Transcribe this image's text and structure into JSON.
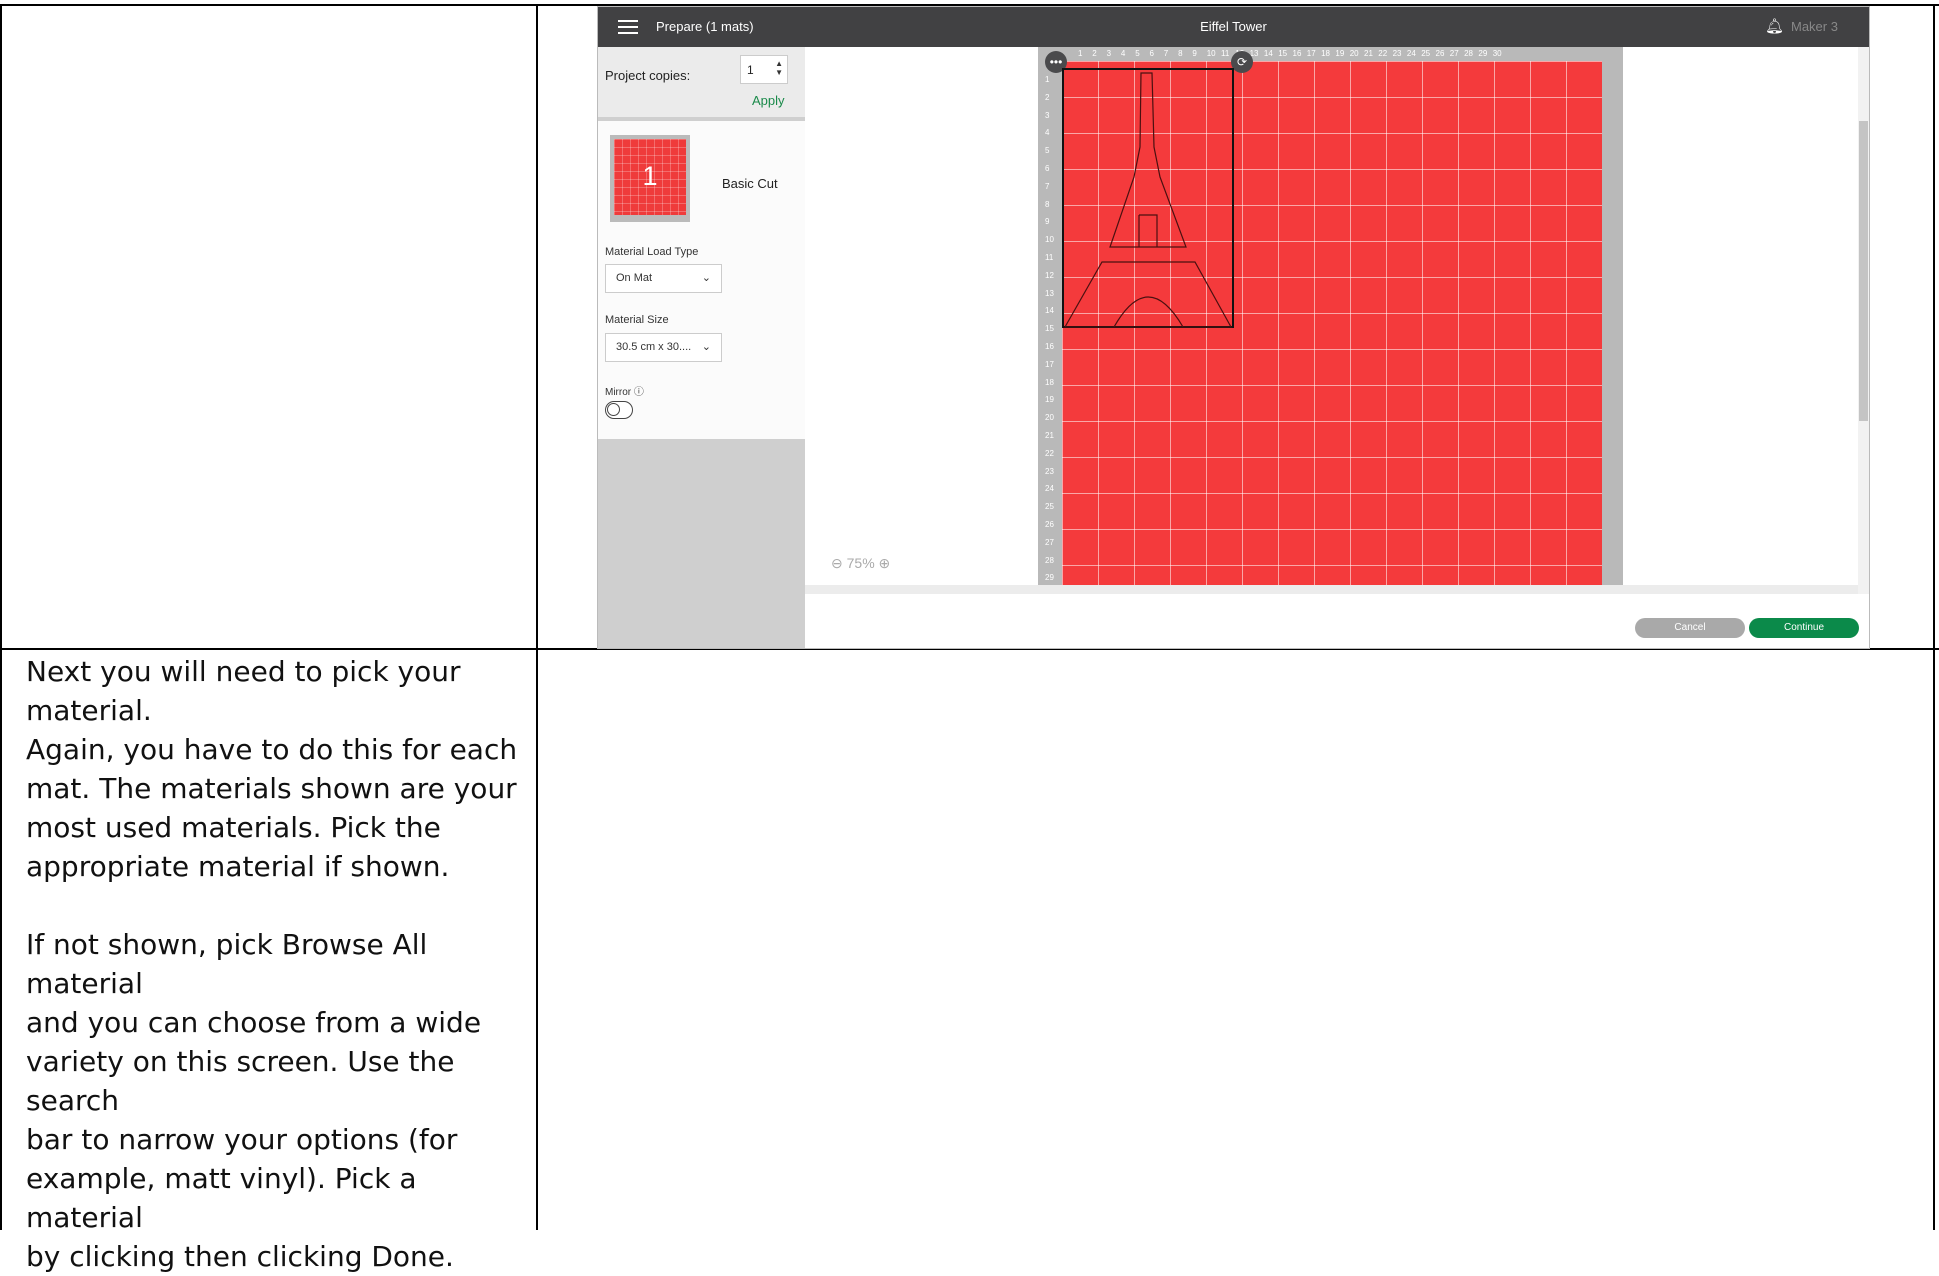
{
  "instructions": {
    "paragraphs": [
      [
        "Next you will need to pick your",
        "material.",
        "Again, you have to do this for each",
        "mat. The materials shown are your",
        "most used materials. Pick the",
        "appropriate material if shown."
      ],
      [
        "If not shown, pick Browse All material",
        "and you can choose from a wide",
        "variety on this screen. Use the search",
        "bar to narrow your options (for",
        "example, matt vinyl). Pick a material",
        "by clicking then clicking Done."
      ]
    ]
  },
  "screenshot": {
    "header": {
      "prepare_label": "Prepare (1 mats)",
      "project_title": "Eiffel Tower",
      "machine_label": "Maker 3",
      "bell_icon": "bell-icon",
      "menu_icon": "hamburger-menu-icon"
    },
    "left_panel": {
      "project_copies_label": "Project copies:",
      "project_copies_value": "1",
      "apply_label": "Apply",
      "mat_number": "1",
      "mat_name": "Basic Cut",
      "material_load_type_label": "Material Load Type",
      "material_load_type_value": "On Mat",
      "material_size_label": "Material Size",
      "material_size_value": "30.5 cm x 30....",
      "mirror_label": "Mirror",
      "mirror_on": false
    },
    "canvas": {
      "zoom_label": "75%",
      "ruler_top": [
        "1",
        "2",
        "3",
        "4",
        "5",
        "6",
        "7",
        "8",
        "9",
        "10",
        "11",
        "12",
        "13",
        "14",
        "15",
        "16",
        "17",
        "18",
        "19",
        "20",
        "21",
        "22",
        "23",
        "24",
        "25",
        "26",
        "27",
        "28",
        "29",
        "30"
      ],
      "ruler_left": [
        "1",
        "2",
        "3",
        "4",
        "5",
        "6",
        "7",
        "8",
        "9",
        "10",
        "11",
        "12",
        "13",
        "14",
        "15",
        "16",
        "17",
        "18",
        "19",
        "20",
        "21",
        "22",
        "23",
        "24",
        "25",
        "26",
        "27",
        "28",
        "29"
      ],
      "mat_color": "#f43a3c"
    },
    "footer": {
      "cancel_label": "Cancel",
      "continue_label": "Continue",
      "continue_color": "#0b8a4a"
    }
  }
}
